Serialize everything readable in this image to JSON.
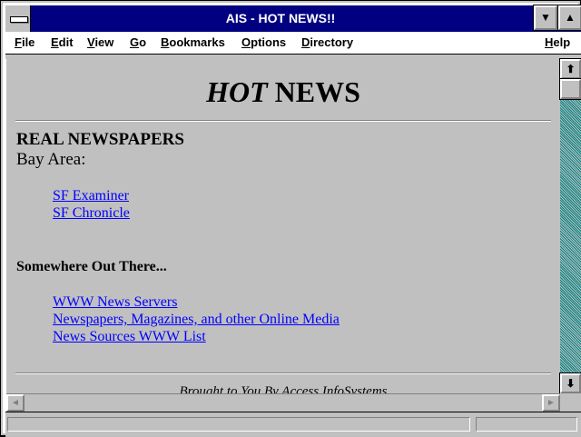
{
  "window": {
    "title": "AIS - HOT NEWS!!",
    "minimize_glyph": "▼",
    "maximize_glyph": "▲"
  },
  "menu": {
    "items": [
      {
        "underline": "F",
        "rest": "ile"
      },
      {
        "underline": "E",
        "rest": "dit"
      },
      {
        "underline": "V",
        "rest": "iew"
      },
      {
        "underline": "G",
        "rest": "o"
      },
      {
        "underline": "B",
        "rest": "ookmarks"
      },
      {
        "underline": "O",
        "rest": "ptions"
      },
      {
        "underline": "D",
        "rest": "irectory"
      }
    ],
    "help": {
      "underline": "H",
      "rest": "elp"
    }
  },
  "page": {
    "heading_italic": "HOT",
    "heading_rest": " NEWS",
    "section1_title": "REAL NEWSPAPERS",
    "section1_sub": "Bay Area:",
    "bay_area_links": [
      "SF Examiner",
      "SF Chronicle"
    ],
    "section2_title": "Somewhere Out There...",
    "out_there_links": [
      "WWW News Servers",
      "Newspapers, Magazines, and other Online Media",
      "News Sources WWW List"
    ],
    "footer": "Brought to You By Access InfoSystems"
  },
  "scrollbars": {
    "up_arrow": "⬆",
    "down_arrow": "⬇",
    "left_arrow": "◄",
    "right_arrow": "►"
  },
  "colors": {
    "titlebar": "#000080",
    "content_bg": "#c0c0c0",
    "link": "#0000ff",
    "scroll_track": "#008080"
  }
}
